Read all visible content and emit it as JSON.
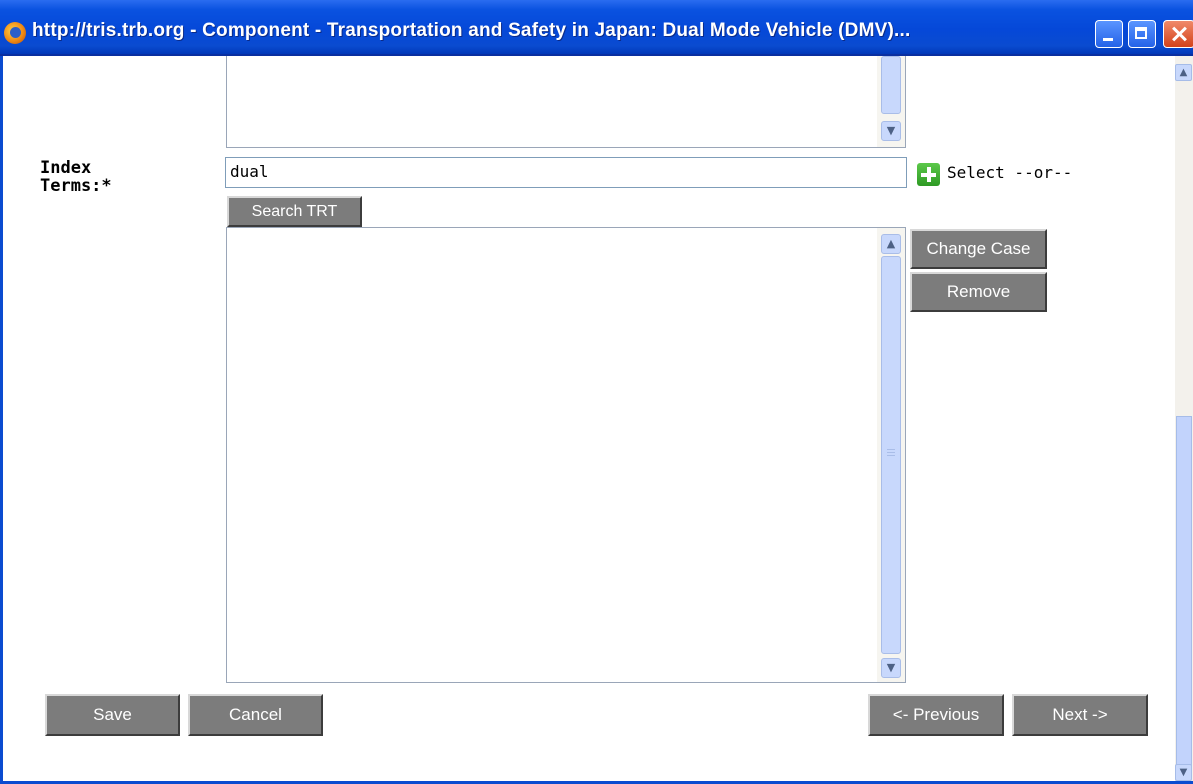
{
  "window": {
    "title": "http://tris.trb.org - Component - Transportation and Safety in Japan: Dual Mode Vehicle (DMV)..."
  },
  "icons": {
    "title_icon": "firefox-icon",
    "add_icon": "green-plus-icon",
    "scroll_up": "▲",
    "scroll_down": "▼"
  },
  "form": {
    "index_label_line1": "Index",
    "index_label_line2": "Terms:*",
    "search_value": "dual",
    "select_link": "Select --or--",
    "search_trt_label": "Search TRT",
    "change_case_label": "Change Case",
    "remove_label": "Remove"
  },
  "footer": {
    "save_label": "Save",
    "cancel_label": "Cancel",
    "previous_label": "<- Previous",
    "next_label": "Next ->"
  },
  "colors": {
    "titlebar": "#0548d8",
    "button_bg": "#7c7c7c",
    "scrollbar_thumb": "#c8d8fc"
  }
}
